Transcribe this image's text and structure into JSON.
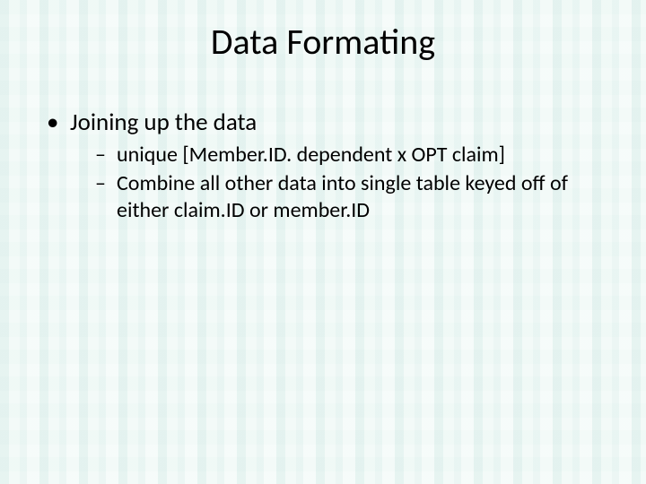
{
  "slide": {
    "title": "Data Formating",
    "bullets": {
      "item1": "Joining up the data",
      "subitems": {
        "s1": "unique [Member.ID. dependent x OPT claim]",
        "s2": "Combine all other data into single table keyed off of either claim.ID or member.ID"
      }
    }
  }
}
